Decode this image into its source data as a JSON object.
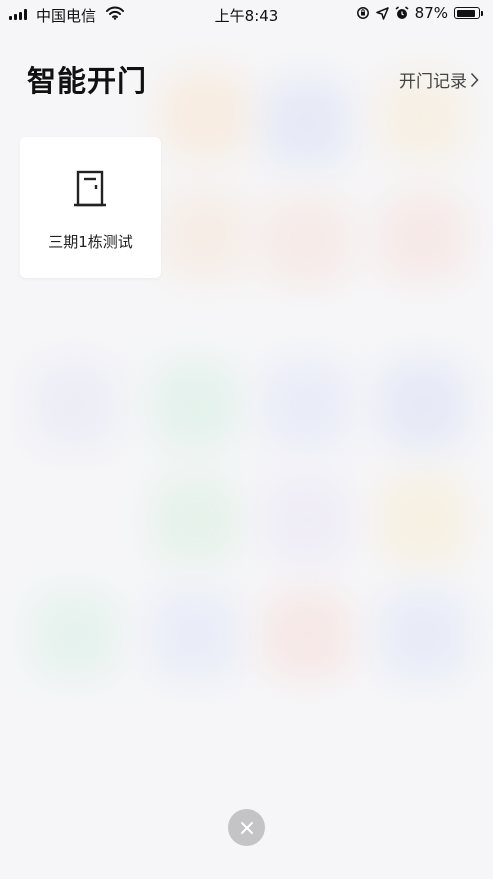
{
  "status_bar": {
    "carrier": "中国电信",
    "time": "上午8:43",
    "battery_percent": "87%",
    "battery_level": 0.87,
    "icons": [
      "signal-icon",
      "wifi-icon",
      "orientation-lock-icon",
      "location-icon",
      "alarm-icon",
      "battery-icon"
    ]
  },
  "header": {
    "title": "智能开门",
    "records_link": "开门记录"
  },
  "doors": [
    {
      "label": "三期1栋测试",
      "icon": "door-icon"
    }
  ],
  "close": {
    "icon": "close-icon"
  },
  "colors": {
    "text_primary": "#111111",
    "card_background": "#ffffff",
    "close_button": "#c4c4c7"
  }
}
